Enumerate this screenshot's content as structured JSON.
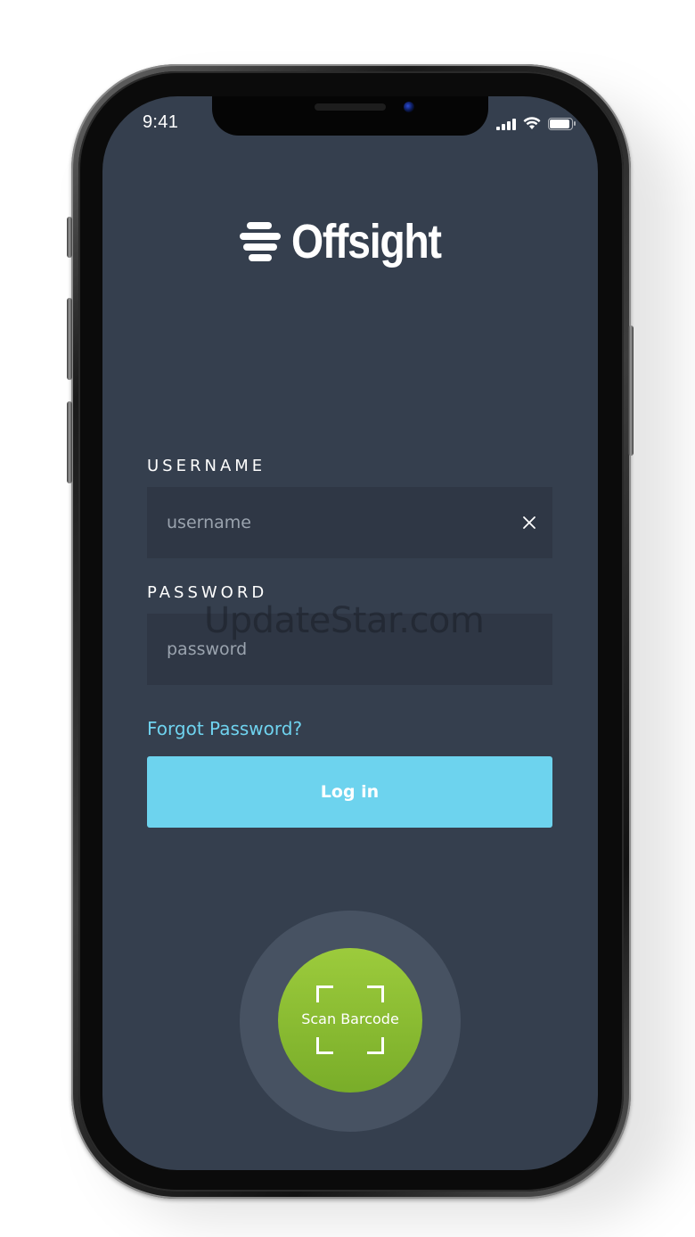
{
  "status_bar": {
    "time": "9:41"
  },
  "logo": {
    "text": "Offsight",
    "icon": "offsight-logo-icon"
  },
  "form": {
    "username": {
      "label": "USERNAME",
      "placeholder": "username",
      "value": "",
      "clear_icon": "close-icon"
    },
    "password": {
      "label": "PASSWORD",
      "placeholder": "password",
      "value": ""
    },
    "forgot_password": "Forgot Password?",
    "login_label": "Log in"
  },
  "scan": {
    "label": "Scan Barcode",
    "icon": "scan-frame-icon"
  },
  "watermark": "UpdateStar.com",
  "colors": {
    "background": "#353f4e",
    "field": "#2f3745",
    "accent": "#6dd3ee",
    "scan_green": "#8cbf33",
    "scan_ring": "#475262"
  }
}
